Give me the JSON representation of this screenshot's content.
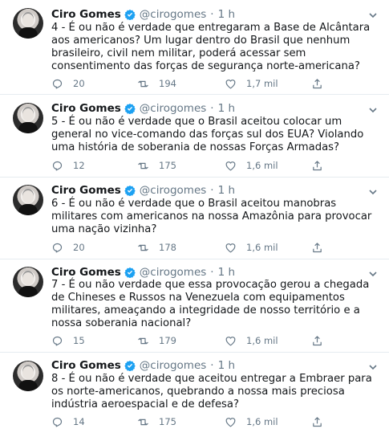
{
  "author": {
    "name": "Ciro Gomes",
    "handle": "@cirogomes",
    "separator": "·"
  },
  "tweets": [
    {
      "time": "1 h",
      "text": "4 - É ou não é verdade que entregaram a Base de Alcântara aos americanos? Um lugar dentro do Brasil que nenhum brasileiro, civil nem militar, poderá acessar sem consentimento das forças de segurança norte-americana?",
      "replies": "20",
      "retweets": "194",
      "likes": "1,7 mil"
    },
    {
      "time": "1 h",
      "text": "5 - É ou não é verdade que o Brasil aceitou colocar um general no vice-comando das forças sul dos EUA? Violando uma história de soberania de nossas Forças Armadas?",
      "replies": "12",
      "retweets": "175",
      "likes": "1,6 mil"
    },
    {
      "time": "1 h",
      "text": "6 - É ou não é verdade que o Brasil aceitou manobras militares com americanos na nossa Amazônia para provocar uma nação vizinha?",
      "replies": "20",
      "retweets": "178",
      "likes": "1,6 mil"
    },
    {
      "time": "1 h",
      "text": "7 - É ou não verdade que essa provocação gerou a chegada de Chineses e Russos na Venezuela com equipamentos militares, ameaçando a integridade de nosso território e a nossa soberania nacional?",
      "replies": "15",
      "retweets": "179",
      "likes": "1,6 mil"
    },
    {
      "time": "1 h",
      "text": "8 - É ou não é verdade que aceitou entregar a Embraer para os norte-americanos, quebrando a nossa mais preciosa indústria aeroespacial e de defesa?",
      "replies": "14",
      "retweets": "175",
      "likes": "1,6 mil"
    }
  ],
  "colors": {
    "verified": "#1da1f2",
    "muted": "#657786",
    "text": "#14171a",
    "divider": "#e6ecf0"
  },
  "icons": [
    "verified-badge-icon",
    "chevron-down-icon",
    "reply-icon",
    "retweet-icon",
    "like-icon",
    "share-icon"
  ]
}
